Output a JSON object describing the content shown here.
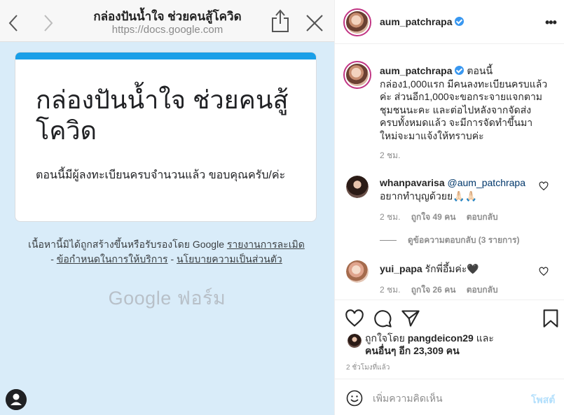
{
  "browser": {
    "title": "กล่องปันน้ำใจ ช่วยคนสู้โควิด",
    "url": "https://docs.google.com"
  },
  "form": {
    "heading": "กล่องปันน้ำใจ ช่วยคนสู้โควิด",
    "message": "ตอนนี้มีผู้ลงทะเบียนครบจำนวนแล้ว ขอบคุณครับ/ค่ะ",
    "accent_color": "#1a9fe8"
  },
  "footer": {
    "disclaimer_text": "เนื้อหานี้มิได้ถูกสร้างขึ้นหรือรับรองโดย Google",
    "report_link": "รายงานการละเมิด",
    "terms_link": "ข้อกำหนดในการให้บริการ",
    "privacy_link": "นโยบายความเป็นส่วนตัว",
    "sep": "-",
    "logo_text": "Google ฟอร์ม"
  },
  "post": {
    "username": "aum_patchrapa",
    "more_label": "•••",
    "caption_username": "aum_patchrapa",
    "caption_text": "ตอนนี้กล่อง1,000แรก มีคนลงทะเบียนครบแล้วค่ะ ส่วนอีก1,000จะขอกระจายแจกตามชุมชนนะคะ และต่อไปหลังจากจัดส่งครบทั้งหมดแล้ว จะมีการจัดทำขึ้นมาใหม่จะมาแจ้งให้ทราบค่ะ",
    "caption_time": "2 ชม."
  },
  "comments": [
    {
      "username": "whanpavarisa",
      "mention": "@aum_patchrapa",
      "text": "อยากทำบุญด้วยย🙏🏻🙏🏻",
      "time": "2 ชม.",
      "likes": "ถูกใจ 49 คน",
      "reply": "ตอบกลับ",
      "view_replies": "ดูข้อความตอบกลับ (3 รายการ)"
    },
    {
      "username": "yui_papa",
      "text": "รักพี่อึ้มค่ะ🖤",
      "time": "2 ชม.",
      "likes": "ถูกใจ 26 คน",
      "reply": "ตอบกลับ"
    }
  ],
  "likes": {
    "prefix": "ถูกใจโดย",
    "liker": "pangdeicon29",
    "and": "และ",
    "others": "คนอื่นๆ อีก 23,309 คน"
  },
  "post_time": "2 ชั่วโมงที่แล้ว",
  "comment_box": {
    "placeholder": "เพิ่มความคิดเห็น",
    "post_label": "โพสต์"
  }
}
